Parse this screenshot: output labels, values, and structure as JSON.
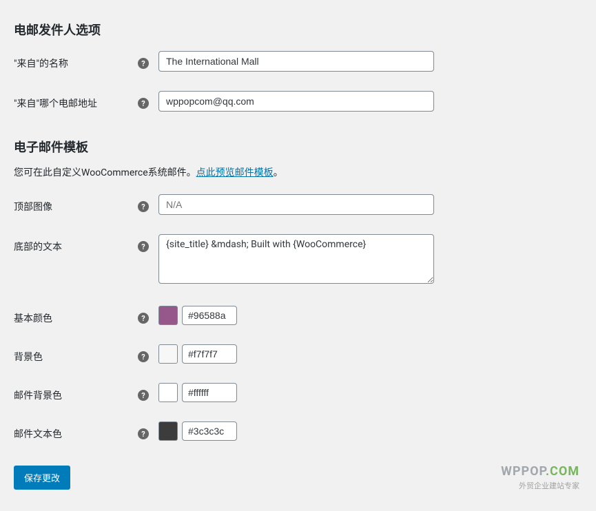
{
  "sections": {
    "sender": {
      "title": "电邮发件人选项",
      "from_name": {
        "label": "\"来自\"的名称",
        "value": "The International Mall"
      },
      "from_address": {
        "label": "\"来自\"哪个电邮地址",
        "value": "wppopcom@qq.com"
      }
    },
    "template": {
      "title": "电子邮件模板",
      "description_prefix": "您可在此自定义WooCommerce系统邮件。",
      "description_link": "点此预览邮件模板",
      "description_suffix": "。",
      "header_image": {
        "label": "顶部图像",
        "placeholder": "N/A",
        "value": ""
      },
      "footer_text": {
        "label": "底部的文本",
        "value": "{site_title} &mdash; Built with {WooCommerce}"
      },
      "base_color": {
        "label": "基本颜色",
        "value": "#96588a",
        "swatch": "#96588a"
      },
      "background_color": {
        "label": "背景色",
        "value": "#f7f7f7",
        "swatch": "#f7f7f7"
      },
      "body_background_color": {
        "label": "邮件背景色",
        "value": "#ffffff",
        "swatch": "#ffffff"
      },
      "body_text_color": {
        "label": "邮件文本色",
        "value": "#3c3c3c",
        "swatch": "#3c3c3c"
      }
    }
  },
  "actions": {
    "save": "保存更改"
  },
  "watermark": {
    "brand_part1": "WPPOP",
    "brand_part2": ".COM",
    "subtitle": "外贸企业建站专家"
  },
  "help_glyph": "?"
}
